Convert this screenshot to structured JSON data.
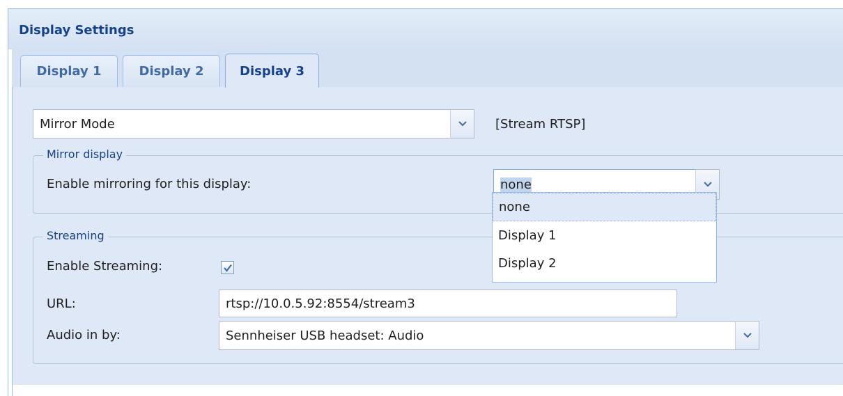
{
  "panel": {
    "title": "Display Settings"
  },
  "tabs": [
    {
      "label": "Display 1"
    },
    {
      "label": "Display 2"
    },
    {
      "label": "Display 3"
    }
  ],
  "active_tab": "Display 3",
  "mode": {
    "value": "Mirror Mode",
    "note": "[Stream RTSP]"
  },
  "mirror": {
    "legend": "Mirror display",
    "label": "Enable mirroring for this display:",
    "value": "none",
    "options": [
      "none",
      "Display 1",
      "Display 2"
    ],
    "highlighted_option": "none"
  },
  "streaming": {
    "legend": "Streaming",
    "enable_label": "Enable Streaming:",
    "enabled": true,
    "url_label": "URL:",
    "url_value": "rtsp://10.0.5.92:8554/stream3",
    "audio_label": "Audio in by:",
    "audio_value": "Sennheiser USB headset: Audio"
  },
  "icons": {
    "trigger": "chevron-down-icon",
    "check": "checkmark-icon"
  },
  "colors": {
    "title": "#15428b",
    "border": "#99bbe8",
    "tab_body": "#dfe8f6",
    "check": "#3b6fb6"
  }
}
